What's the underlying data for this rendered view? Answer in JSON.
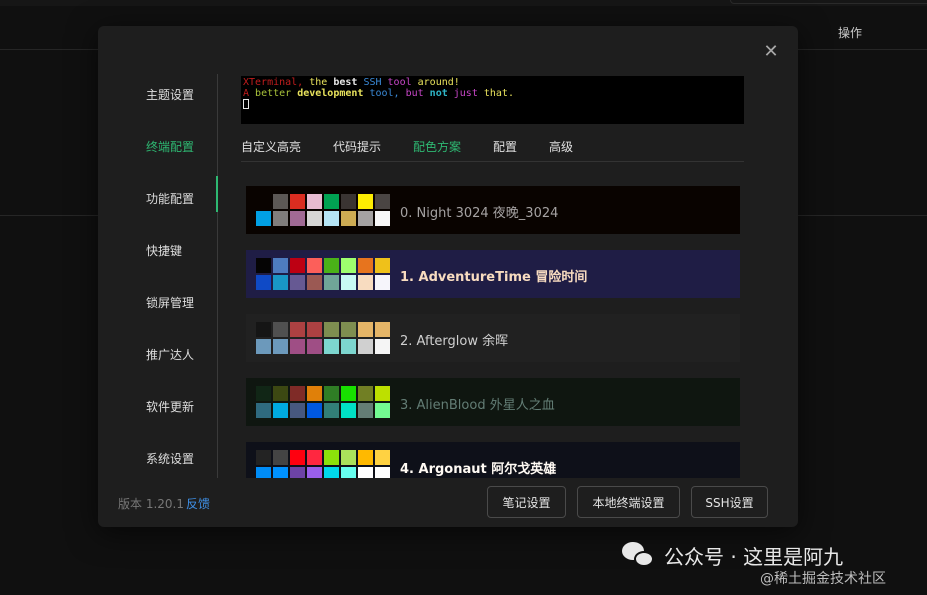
{
  "background": {
    "header_label": "操作"
  },
  "modal": {
    "close_icon": "close-icon",
    "sidebar": {
      "items": [
        {
          "label": "主题设置"
        },
        {
          "label": "终端配置",
          "active": true
        },
        {
          "label": "功能配置"
        },
        {
          "label": "快捷键"
        },
        {
          "label": "锁屏管理"
        },
        {
          "label": "推广达人"
        },
        {
          "label": "软件更新"
        },
        {
          "label": "系统设置"
        }
      ]
    },
    "terminal_preview": {
      "line1": [
        "XTerminal, ",
        "the ",
        "best ",
        "SSH ",
        "tool ",
        "around!"
      ],
      "line2": [
        "A ",
        "better ",
        "development ",
        "tool, ",
        "but ",
        "not ",
        "just ",
        "that."
      ]
    },
    "tabs": [
      {
        "label": "自定义高亮"
      },
      {
        "label": "代码提示"
      },
      {
        "label": "配色方案",
        "active": true
      },
      {
        "label": "配置"
      },
      {
        "label": "高级"
      }
    ],
    "schemes": [
      {
        "name": "0. Night 3024 夜晚_3024",
        "bg": "#090300",
        "text": "#a5a2a2",
        "row1": [
          "#090300",
          "#5c5855",
          "#db2d20",
          "#e8bbd0",
          "#01a252",
          "#3a3432",
          "#fded02",
          "#4a4543"
        ],
        "row2": [
          "#01a0e4",
          "#807d7c",
          "#a16a94",
          "#d6d5d4",
          "#b5e4f4",
          "#cdab53",
          "#a5a2a2",
          "#f7f7f7"
        ]
      },
      {
        "name": "1. AdventureTime 冒险时间",
        "bg": "#1f1d45",
        "text": "#f8dcc0",
        "bold": true,
        "row1": [
          "#050404",
          "#4e7cbf",
          "#bd0013",
          "#fc5f5a",
          "#4ab118",
          "#9eff6e",
          "#e7741e",
          "#efc11a"
        ],
        "row2": [
          "#0f4ac6",
          "#1997c6",
          "#665993",
          "#9b5953",
          "#70a598",
          "#c8faf4",
          "#f8dcc0",
          "#f6f5fb"
        ]
      },
      {
        "name": "2. Afterglow 余晖",
        "bg": "#212121",
        "text": "#d0d0d0",
        "row1": [
          "#151515",
          "#505050",
          "#ac4142",
          "#ac4142",
          "#7e8e50",
          "#7e8e50",
          "#e5b567",
          "#e5b567"
        ],
        "row2": [
          "#6c99bb",
          "#6c99bb",
          "#9f4e85",
          "#9f4e85",
          "#7dd6cf",
          "#7dd6cf",
          "#d0d0d0",
          "#f5f5f5"
        ]
      },
      {
        "name": "3. AlienBlood 外星人之血",
        "bg": "#0f1610",
        "text": "#637d75",
        "row1": [
          "#112616",
          "#3c4812",
          "#7f2b27",
          "#e08009",
          "#2f7e25",
          "#18e000",
          "#717f24",
          "#bde000"
        ],
        "row2": [
          "#2f6a7f",
          "#00aae0",
          "#47587f",
          "#0058e0",
          "#327f77",
          "#00e0c4",
          "#647d75",
          "#73fa91"
        ]
      },
      {
        "name": "4. Argonaut 阿尔戈英雄",
        "bg": "#0e1019",
        "text": "#fffaf4",
        "bold": true,
        "row1": [
          "#232323",
          "#444444",
          "#ff000f",
          "#ff2740",
          "#8ce10b",
          "#abe15b",
          "#ffb900",
          "#ffd242"
        ],
        "row2": [
          "#008df8",
          "#0092ff",
          "#6d43a6",
          "#9a5feb",
          "#00d8eb",
          "#67fff0",
          "#ffffff",
          "#ffffff"
        ]
      }
    ],
    "footer": {
      "version": "版本 1.20.1",
      "feedback": "反馈",
      "buttons": [
        "笔记设置",
        "本地终端设置",
        "SSH设置"
      ]
    }
  },
  "watermark": {
    "main": "公众号 · 这里是阿九",
    "sub": "@稀土掘金技术社区",
    "icon": "wechat-icon"
  }
}
